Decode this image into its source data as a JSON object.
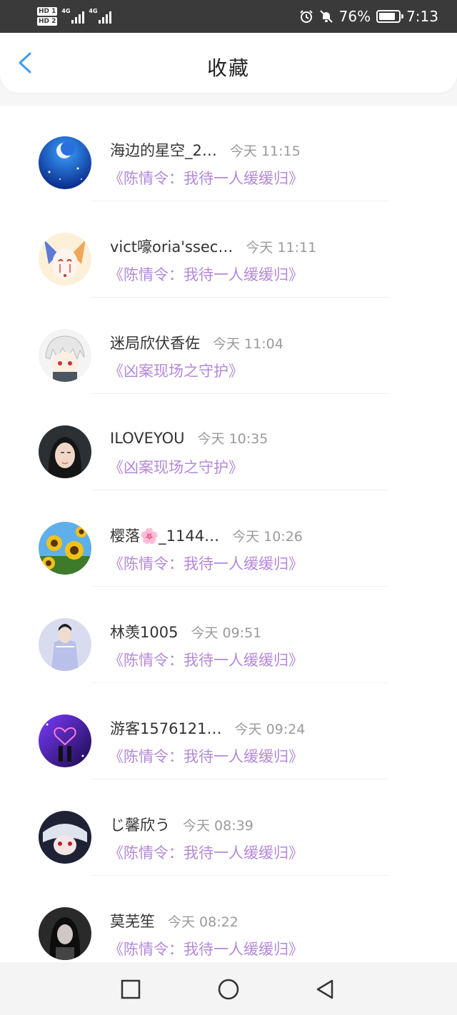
{
  "status_bar": {
    "sim1": "HD",
    "sim1_num": "1",
    "sim2": "HD",
    "sim2_num": "2",
    "net1": "4G",
    "net2": "4G",
    "battery_percent": "76%",
    "time": "7:13",
    "icons": [
      "alarm-icon",
      "bell-muted-icon",
      "battery-icon"
    ]
  },
  "header": {
    "title": "收藏",
    "back_icon": "chevron-left-icon",
    "accent_color": "#3d9df2"
  },
  "favorites": [
    {
      "username": "海边的星空_2…",
      "time": "今天 11:15",
      "drama": "《陈情令：我待一人缓缓归》"
    },
    {
      "username": "vict嚎oria'ssec…",
      "time": "今天 11:11",
      "drama": "《陈情令：我待一人缓缓归》"
    },
    {
      "username": "迷局欣伏香佐",
      "time": "今天 11:04",
      "drama": "《凶案现场之守护》"
    },
    {
      "username": "ILOVEYOU",
      "time": "今天 10:35",
      "drama": "《凶案现场之守护》"
    },
    {
      "username": "樱落🌸_1144…",
      "time": "今天 10:26",
      "drama": "《陈情令：我待一人缓缓归》"
    },
    {
      "username": "林羡1005",
      "time": "今天 09:51",
      "drama": "《陈情令：我待一人缓缓归》"
    },
    {
      "username": "游客1576121…",
      "time": "今天 09:24",
      "drama": "《陈情令：我待一人缓缓归》"
    },
    {
      "username": "じ馨欣う",
      "time": "今天 08:39",
      "drama": "《陈情令：我待一人缓缓归》"
    },
    {
      "username": "莫芜笙",
      "time": "今天 08:22",
      "drama": "《陈情令：我待一人缓缓归》"
    }
  ],
  "colors": {
    "drama_text": "#b388d8",
    "time_text": "#9a9a9a",
    "status_bar_bg": "#3a3a3a"
  },
  "nav_bar": {
    "icons": [
      "recent-apps-icon",
      "home-icon",
      "back-triangle-icon"
    ]
  }
}
